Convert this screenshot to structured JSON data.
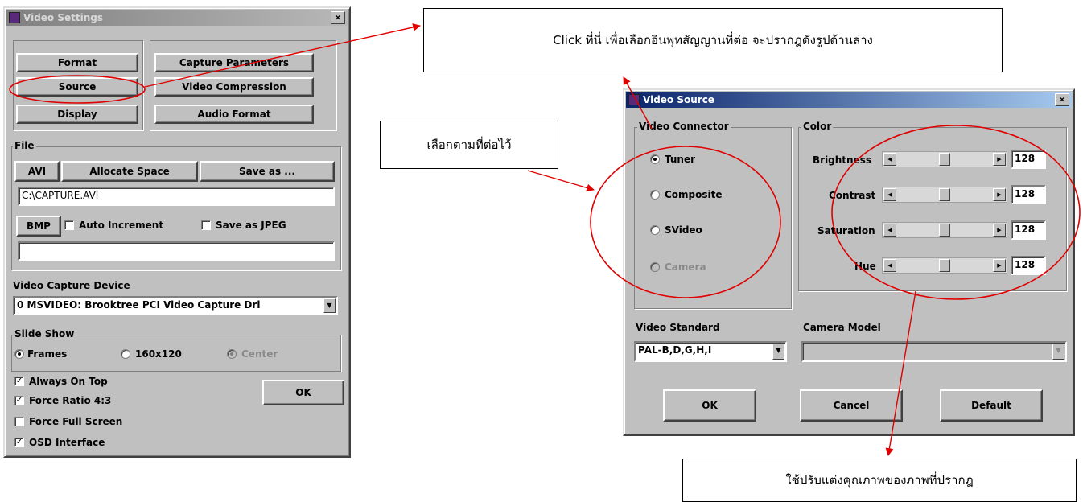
{
  "video_settings": {
    "title": "Video Settings",
    "close_glyph": "×",
    "buttons": {
      "format": "Format",
      "source": "Source",
      "display": "Display",
      "capture_parameters": "Capture Parameters",
      "video_compression": "Video Compression",
      "audio_format": "Audio Format"
    },
    "file": {
      "label": "File",
      "avi": "AVI",
      "allocate_space": "Allocate Space",
      "save_as": "Save as ...",
      "path_value": "C:\\CAPTURE.AVI",
      "bmp": "BMP",
      "auto_increment": "Auto Increment",
      "save_as_jpeg": "Save as JPEG",
      "bmp_path_value": ""
    },
    "device": {
      "label": "Video Capture Device",
      "selected": "0 MSVIDEO: Brooktree PCI Video Capture Dri"
    },
    "slide_show": {
      "label": "Slide Show",
      "options": [
        "Frames",
        "160x120",
        "Center"
      ],
      "selected": "Frames"
    },
    "checkboxes": [
      {
        "label": "Always On Top",
        "checked": true
      },
      {
        "label": "Force Ratio 4:3",
        "checked": true
      },
      {
        "label": "Force Full Screen",
        "checked": false
      },
      {
        "label": "OSD Interface",
        "checked": true
      }
    ],
    "ok": "OK"
  },
  "video_source": {
    "title": "Video Source",
    "close_glyph": "×",
    "connector": {
      "label": "Video Connector",
      "options": [
        "Tuner",
        "Composite",
        "SVideo",
        "Camera"
      ],
      "selected": "Tuner"
    },
    "color": {
      "label": "Color",
      "rows": [
        {
          "label": "Brightness",
          "value": "128"
        },
        {
          "label": "Contrast",
          "value": "128"
        },
        {
          "label": "Saturation",
          "value": "128"
        },
        {
          "label": "Hue",
          "value": "128"
        }
      ]
    },
    "standard": {
      "label": "Video Standard",
      "selected": "PAL-B,D,G,H,I"
    },
    "camera_model": {
      "label": "Camera Model",
      "selected": ""
    },
    "ok": "OK",
    "cancel": "Cancel",
    "default": "Default"
  },
  "callouts": {
    "top": "Click ที่นี่ เพื่อเลือกอินพุทสัญญานที่ต่อ จะปรากฎดังรูปด้านล่าง",
    "left": "เลือกตามที่ต่อไว้",
    "bottom": "ใช้ปรับแต่งคุณภาพของภาพที่ปรากฎ"
  },
  "colors": {
    "annotation": "#e00000",
    "window_face": "#c0c0c0",
    "active_title": "#0a246a",
    "inactive_title": "#808080"
  }
}
